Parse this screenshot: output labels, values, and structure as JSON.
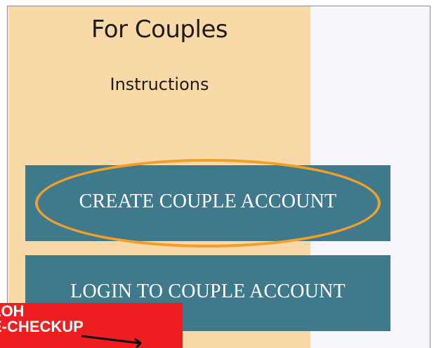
{
  "panel": {
    "title": "For Couples",
    "instructions_link": "Instructions"
  },
  "buttons": {
    "create_label": "CREATE COUPLE ACCOUNT",
    "login_label": "LOGIN TO COUPLE ACCOUNT"
  },
  "callout": {
    "line1": "LOH",
    "line2": "E-CHECKUP"
  },
  "colors": {
    "peach": "#f9d9a7",
    "button_teal": "#3f7a8c",
    "highlight_orange": "#f0a02a",
    "callout_red": "#ee1d20",
    "panel_bg": "#f7f6fd"
  }
}
